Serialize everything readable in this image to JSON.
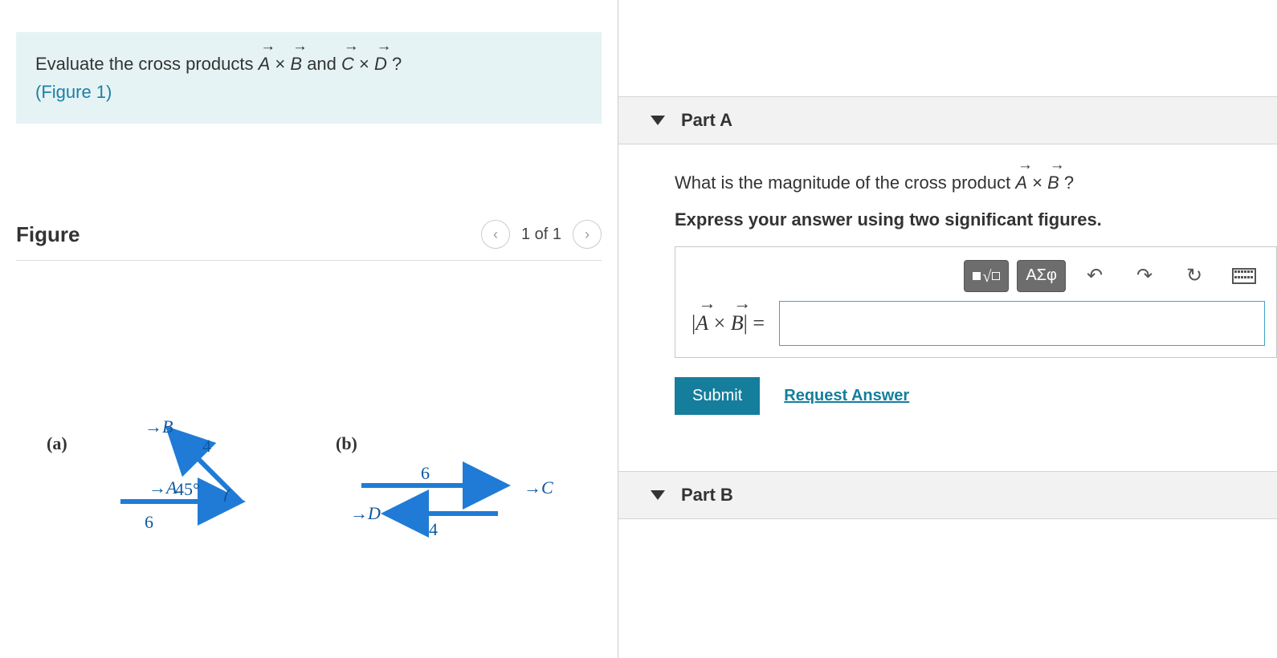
{
  "prompt": {
    "prefix": "Evaluate the cross products ",
    "vecA": "A",
    "times1": " × ",
    "vecB": "B",
    "mid": " and ",
    "vecC": "C",
    "times2": " × ",
    "vecD": "D",
    "suffix": "?",
    "figure_link": "(Figure 1)"
  },
  "figure": {
    "title": "Figure",
    "counter": "1 of 1",
    "label_a": "(a)",
    "label_b": "(b)",
    "vecA_label": "A",
    "vecB_label": "B",
    "vecC_label": "C",
    "vecD_label": "D",
    "len_A": "6",
    "len_B": "4",
    "angle_AB": "45°",
    "len_C": "6",
    "len_D": "4"
  },
  "partA": {
    "title": "Part A",
    "question_prefix": "What is the magnitude of the cross product ",
    "vecA": "A",
    "times": " × ",
    "vecB": "B",
    "question_suffix": "?",
    "instruction": "Express your answer using two significant figures.",
    "lhs_open": "|",
    "lhs_vecA": "A",
    "lhs_times": " × ",
    "lhs_vecB": "B",
    "lhs_close": "| = ",
    "answer_value": "",
    "toolbar": {
      "templates_label": "■√☐",
      "greek_label": "ΑΣφ"
    },
    "submit_label": "Submit",
    "request_label": "Request Answer"
  },
  "partB": {
    "title": "Part B"
  }
}
